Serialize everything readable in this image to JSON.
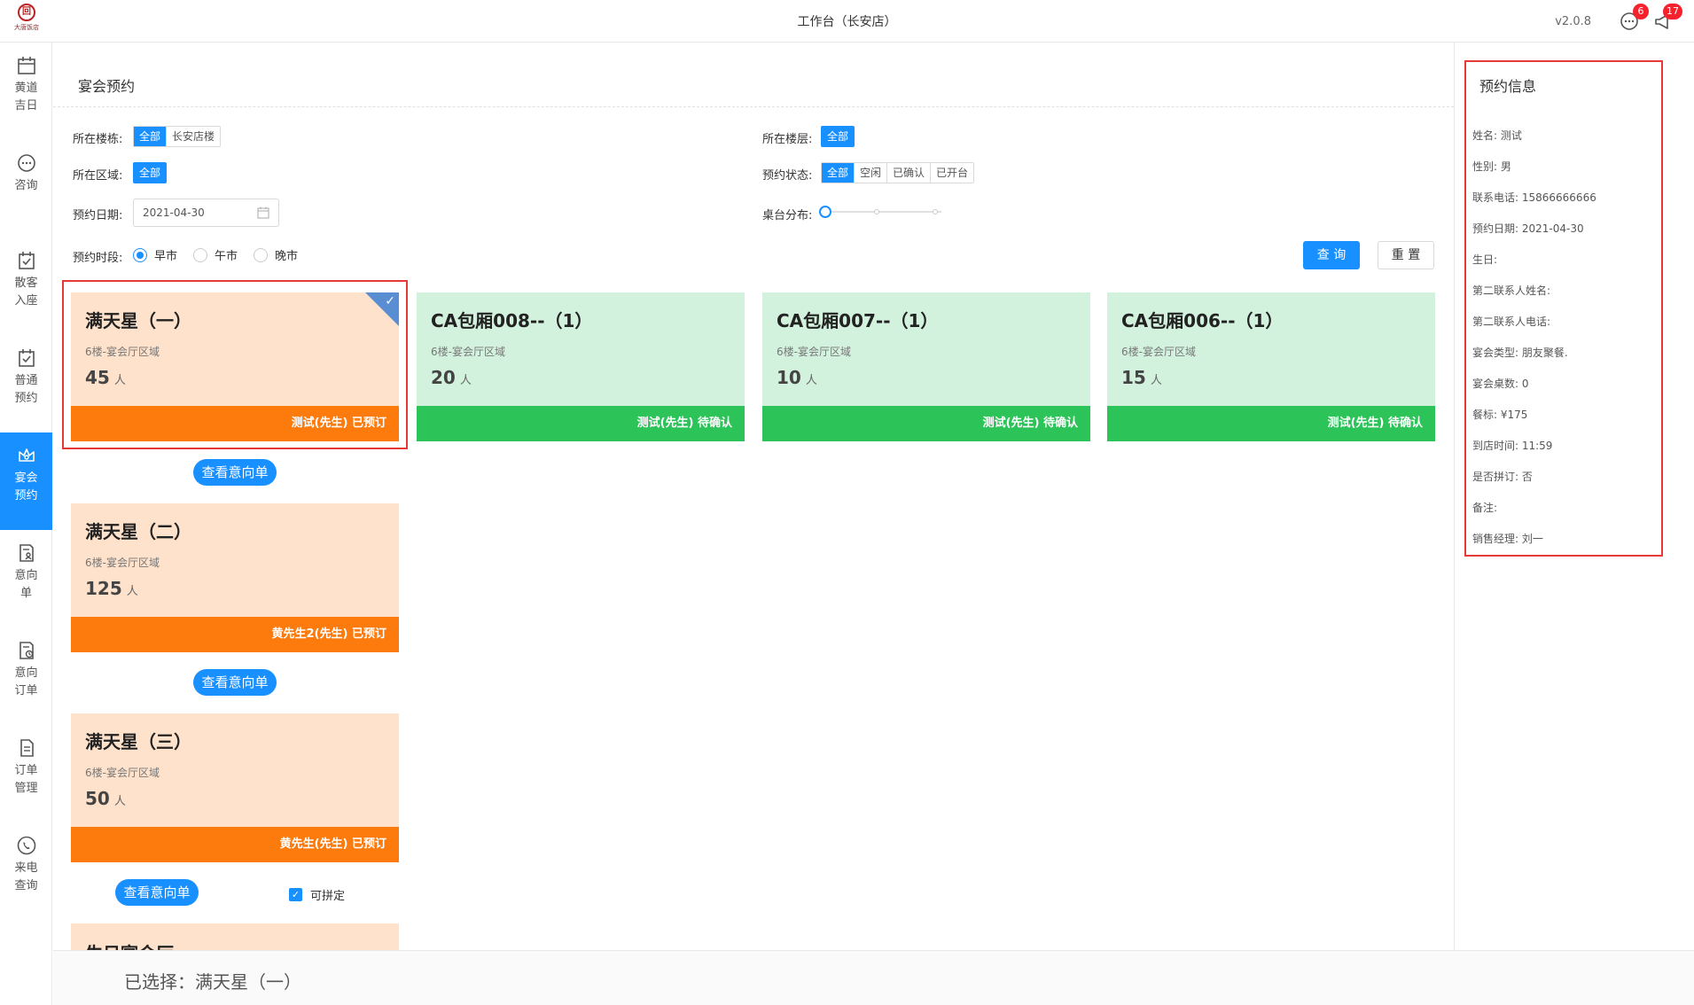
{
  "header": {
    "title": "工作台（长安店）",
    "version": "v2.0.8",
    "message_badge": "6",
    "notice_badge": "17",
    "logo_glyph": "回",
    "logo_text": "大唐饭店"
  },
  "sidebar": {
    "items": [
      {
        "label": "黄道吉日",
        "icon": "calendar-icon",
        "active": false
      },
      {
        "label": "咨询",
        "icon": "chat-icon",
        "active": false
      },
      {
        "label": "散客入座",
        "icon": "calendar-check-icon",
        "active": false
      },
      {
        "label": "普通预约",
        "icon": "calendar-check-icon",
        "active": false
      },
      {
        "label": "宴会预约",
        "icon": "crown-icon",
        "active": true
      },
      {
        "label": "意向单",
        "icon": "document-person-icon",
        "active": false
      },
      {
        "label": "意向订单",
        "icon": "document-clock-icon",
        "active": false
      },
      {
        "label": "订单管理",
        "icon": "document-icon",
        "active": false
      },
      {
        "label": "来电查询",
        "icon": "phone-icon",
        "active": false
      }
    ]
  },
  "page": {
    "title": "宴会预约"
  },
  "filters": {
    "building": {
      "label": "所在楼栋:",
      "options": [
        "全部",
        "长安店楼"
      ],
      "selected": 0
    },
    "floor": {
      "label": "所在楼层:",
      "options": [
        "全部"
      ],
      "selected": 0
    },
    "area": {
      "label": "所在区域:",
      "options": [
        "全部"
      ],
      "selected": 0
    },
    "status": {
      "label": "预约状态:",
      "options": [
        "全部",
        "空闲",
        "已确认",
        "已开台"
      ],
      "selected": 0
    },
    "date": {
      "label": "预约日期:",
      "value": "2021-04-30"
    },
    "tables": {
      "label": "桌台分布:",
      "level": 0
    },
    "period": {
      "label": "预约时段:",
      "options": [
        "早市",
        "午市",
        "晚市"
      ],
      "selected": 0
    },
    "search_label": "查 询",
    "reset_label": "重 置"
  },
  "rooms": [
    {
      "name": "满天星（一）",
      "area": "6楼-宴会厅区域",
      "capacity": "45",
      "unit": "人",
      "status": "测试(先生) 已预订",
      "color": "orange",
      "selected": true
    },
    {
      "name": "CA包厢008--（1）",
      "area": "6楼-宴会厅区域",
      "capacity": "20",
      "unit": "人",
      "status": "测试(先生) 待确认",
      "color": "green",
      "selected": false
    },
    {
      "name": "CA包厢007--（1）",
      "area": "6楼-宴会厅区域",
      "capacity": "10",
      "unit": "人",
      "status": "测试(先生) 待确认",
      "color": "green",
      "selected": false
    },
    {
      "name": "CA包厢006--（1）",
      "area": "6楼-宴会厅区域",
      "capacity": "15",
      "unit": "人",
      "status": "测试(先生) 待确认",
      "color": "green",
      "selected": false
    },
    {
      "name": "满天星（二）",
      "area": "6楼-宴会厅区域",
      "capacity": "125",
      "unit": "人",
      "status": "黄先生2(先生) 已预订",
      "color": "orange",
      "selected": false
    },
    {
      "name": "满天星（三）",
      "area": "6楼-宴会厅区域",
      "capacity": "50",
      "unit": "人",
      "status": "黄先生(先生) 已预订",
      "color": "orange",
      "selected": false
    },
    {
      "name": "生日宴会厅",
      "area": "",
      "capacity": "",
      "unit": "",
      "status": "",
      "color": "orange",
      "selected": false
    }
  ],
  "view_order_label": "查看意向单",
  "combinable_label": "可拼定",
  "booking_info": {
    "title": "预约信息",
    "rows": [
      "姓名: 测试",
      "性别: 男",
      "联系电话: 15866666666",
      "预约日期: 2021-04-30",
      "生日:",
      "第二联系人姓名:",
      "第二联系人电话:",
      "宴会类型: 朋友聚餐.",
      "宴会桌数: 0",
      "餐标: ¥175",
      "到店时间: 11:59",
      "是否拼订: 否",
      "备注:",
      "销售经理: 刘一"
    ]
  },
  "bottom": {
    "selected_text": "已选择：满天星（一）"
  },
  "colors": {
    "accent": "#1890ff",
    "booked": "#fd7b0c",
    "pending": "#2cc359",
    "highlight": "#e53935"
  }
}
